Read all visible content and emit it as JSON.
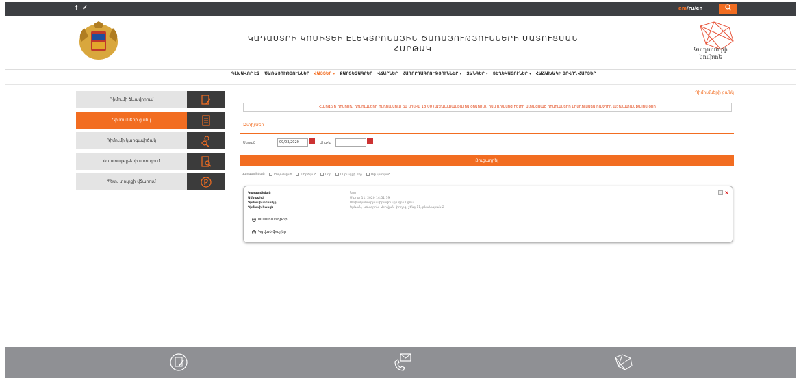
{
  "topbar": {
    "social": "f ✔",
    "lang_active": "am",
    "lang_rest": "/ru/en",
    "search_icon": "search-icon"
  },
  "header": {
    "title": "ԿԱԴԱՍՏՐԻ ԿՈՄԻՏԵԻ ԷԼԵԿՏՐՈՆԱՅԻՆ ԾԱՌԱՅՈՒԹՅՈՒՆՆԵՐԻ ՄԱՏՈՒՑՄԱՆ ՀԱՐԹԱԿ",
    "logo_line1": "Կադաստրի",
    "logo_line2": "կոմիտե"
  },
  "nav": {
    "items": [
      "ԳԼԽԱՎՈՐ ԷՋ",
      "ԾԱՌԱՅՈՒԹՅՈՒՆՆԵՐ",
      "ՀԱՅՏԵՐ ▾",
      "ՔԱՐՏԵԶԱԳՐԵՐ",
      "ՎՃԱՐՆԵՐ",
      "ՀԱՂՈՐԴԱԳՐՈՒԹՅՈՒՆՆԵՐ ▾",
      "ԶԱՆԳԵՐ ▾",
      "ՏԵՂԵԿԱՏՈՒՆԵՐ ▾",
      "ՀԱՃԱԽԱԿԻ ՏՐՎՈՂ ՀԱՐՑԵՐ"
    ],
    "active_index": 2
  },
  "sidebar": {
    "items": [
      {
        "label": "Դիմումի ձևավորում",
        "icon": "document-pencil-icon"
      },
      {
        "label": "Դիմումների ցանկ",
        "icon": "list-document-icon"
      },
      {
        "label": "Դիմումի կարգավիճակ",
        "icon": "search-person-icon"
      },
      {
        "label": "Փաստաթղթերի ստուգում",
        "icon": "document-search-icon"
      },
      {
        "label": "Պետ. տուրքի վճարում",
        "icon": "payment-icon"
      }
    ],
    "active_index": 1
  },
  "content": {
    "breadcrumb": "Դիմումների ցանկ",
    "notice": "Հարգելի դիմորդ, դիմումները ընդունվում են մինչև 18:00 (աշխատանքային օրերին), իսկ դրանից հետո ստացված դիմումները կընդունվեն հաջորդ աշխատանքային օրը",
    "filter_title": "Զտիչներ",
    "from_label": "Սկսած",
    "from_value": "09/03/2020",
    "to_label": "Մինչև",
    "to_value": "",
    "filter_button": "Ցուցադրել",
    "statuses_label": "Կարգավիճակ",
    "statuses": [
      "Ընդունված",
      "Մերժված",
      "Նոր",
      "Ընթացքի մեջ",
      "Ավարտված"
    ]
  },
  "application": {
    "fields": [
      {
        "key": "Կարգավիճակ",
        "value": "Նոր"
      },
      {
        "key": "Ամսաթիվ",
        "value": "Մարտ 11, 2020 14:51:19"
      },
      {
        "key": "Դիմումի տեսակը",
        "value": "Սեփականության իրավունքի գրանցում"
      },
      {
        "key": "Դիմումի հասցե",
        "value": "Երևան, Կենտրոն, Աբովյան փողոց, շենք 11, բնակարան 2"
      }
    ],
    "expand_items": [
      "Փաստաթղթեր",
      "Կցված ֆայլեր"
    ]
  },
  "footer": {
    "icons": [
      "document-pen-icon",
      "phone-mail-icon",
      "map-network-icon"
    ]
  }
}
